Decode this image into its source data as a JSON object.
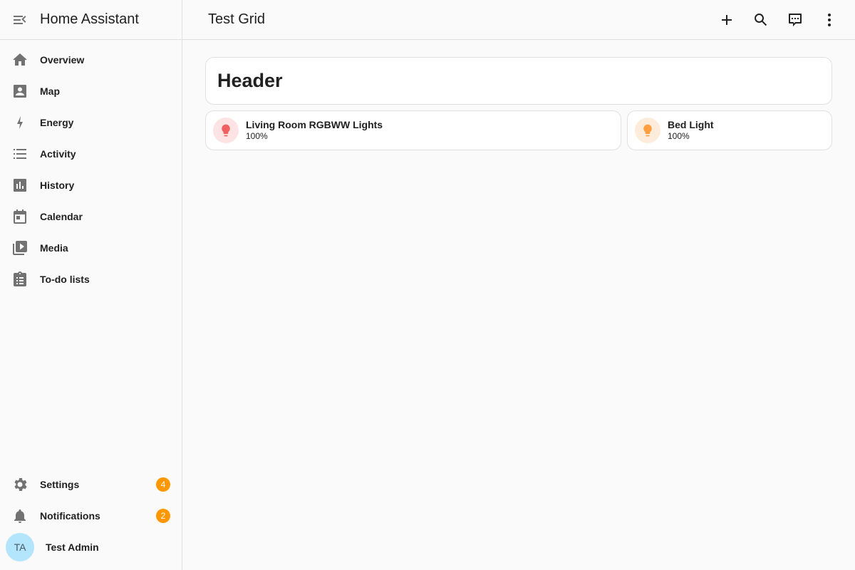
{
  "app": {
    "title": "Home Assistant"
  },
  "page": {
    "title": "Test Grid"
  },
  "sidebar": {
    "items": [
      {
        "label": "Overview",
        "icon": "home-icon"
      },
      {
        "label": "Map",
        "icon": "map-icon"
      },
      {
        "label": "Energy",
        "icon": "lightning-icon"
      },
      {
        "label": "Activity",
        "icon": "list-icon"
      },
      {
        "label": "History",
        "icon": "chart-icon"
      },
      {
        "label": "Calendar",
        "icon": "calendar-icon"
      },
      {
        "label": "Media",
        "icon": "media-icon"
      },
      {
        "label": "To-do lists",
        "icon": "clipboard-icon"
      }
    ],
    "settings": {
      "label": "Settings",
      "badge": "4"
    },
    "notifications": {
      "label": "Notifications",
      "badge": "2"
    },
    "user": {
      "initials": "TA",
      "name": "Test Admin"
    }
  },
  "toolbar": {
    "icons": [
      "plus-icon",
      "search-icon",
      "assist-icon",
      "more-vert-icon"
    ]
  },
  "dashboard": {
    "header_card": {
      "text": "Header"
    },
    "tiles": [
      {
        "name": "Living Room RGBWW Lights",
        "state": "100%",
        "icon_color": "#f06060",
        "icon_bg": "#fde3e3"
      },
      {
        "name": "Bed Light",
        "state": "100%",
        "icon_color": "#ff9f40",
        "icon_bg": "#fdecd9"
      }
    ]
  },
  "colors": {
    "badge": "#ff9800",
    "avatar_bg": "#b3e5fc",
    "icon_gray": "#727272"
  }
}
